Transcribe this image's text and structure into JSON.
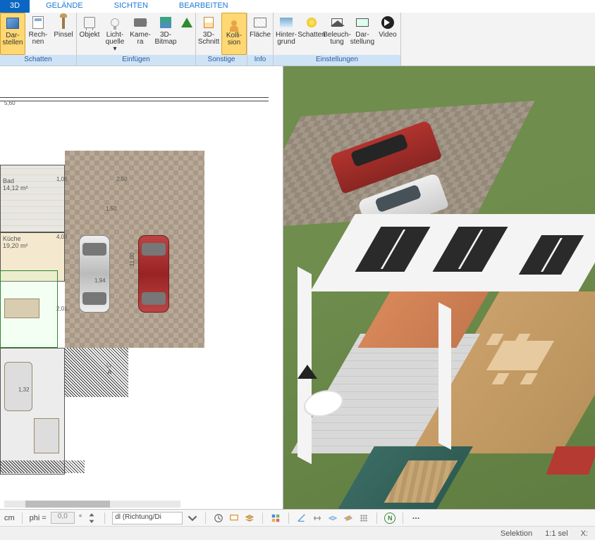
{
  "tabs": {
    "t0": "3D",
    "t1": "GELÄNDE",
    "t2": "SICHTEN",
    "t3": "BEARBEITEN"
  },
  "ribbon": {
    "groups": {
      "schatten": {
        "label": "Schatten",
        "darstellen": "Dar-\nstellen",
        "rechnen": "Rech-\nnen",
        "pinsel": "Pinsel"
      },
      "einfugen": {
        "label": "Einfügen",
        "objekt": "Objekt",
        "licht": "Licht-\nquelle ▾",
        "kamera": "Kame-\nra",
        "bitmap": "3D-\nBitmap",
        "baum": ""
      },
      "sonstige": {
        "label": "Sonstige",
        "schnitt": "3D-\nSchnitt",
        "kollision": "Kolli-\nsion"
      },
      "info": {
        "label": "Info",
        "flaeche": "Fläche"
      },
      "einstellungen": {
        "label": "Einstellungen",
        "hinter": "Hinter-\ngrund",
        "schatten": "Schatten",
        "beleucht": "Beleuch-\ntung",
        "darstellung": "Dar-\nstellung",
        "video": "Video"
      }
    }
  },
  "plan": {
    "dim_top": "5,60",
    "rooms": {
      "bad": "Bad",
      "bad_area": "14,12 m²",
      "kueche": "Küche",
      "kueche_area": "19,20 m²"
    },
    "marker_a": "A",
    "dims": {
      "d1": "1,06",
      "d2": "2,50",
      "d3": "1,50",
      "d4": "4,03",
      "d5": "2,01",
      "d6": "1,32",
      "d7": "11,00",
      "d8": "1,94"
    }
  },
  "toolbar": {
    "unit": "cm",
    "phi": "phi =",
    "phi_val": "0,0",
    "deg": "°",
    "direction": "dl (Richtung/Di"
  },
  "status": {
    "selektion": "Selektion",
    "ratio": "1:1 sel",
    "x": "X:"
  }
}
